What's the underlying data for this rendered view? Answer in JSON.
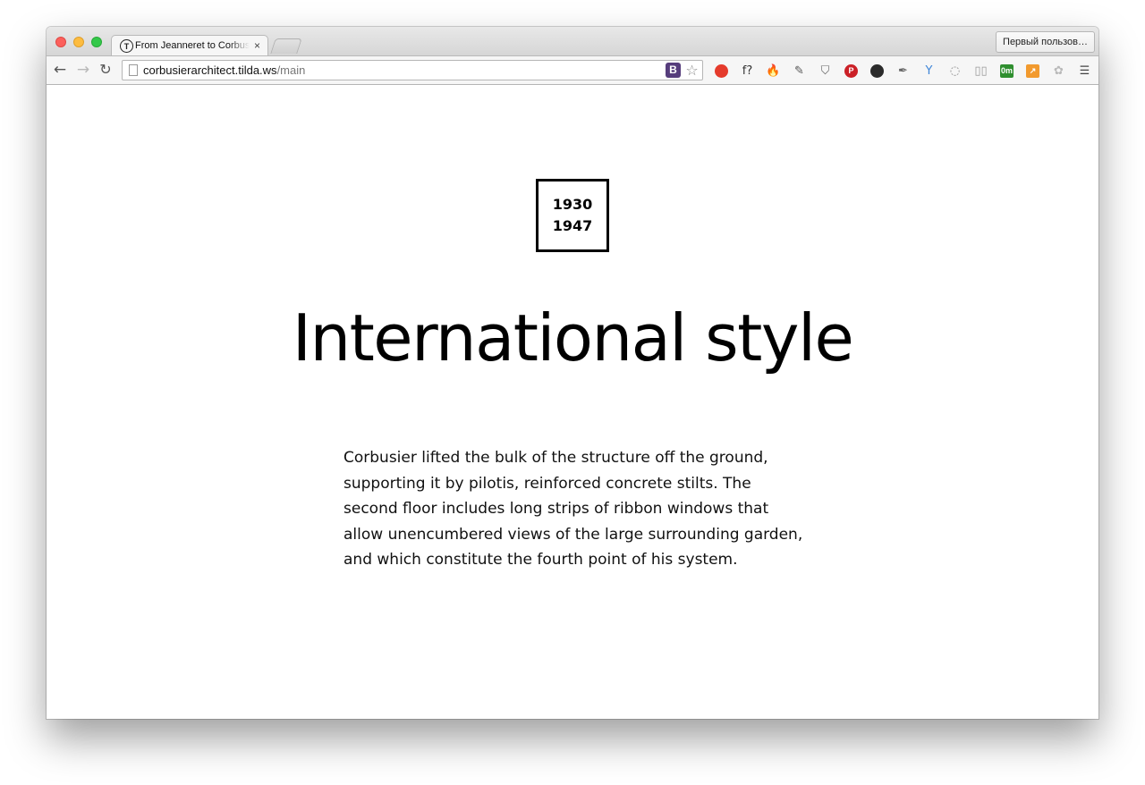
{
  "browser": {
    "tab": {
      "favicon": "T",
      "title": "From Jeanneret to Corbusier",
      "close": "×"
    },
    "profile_button": "Первый пользов…",
    "nav": {
      "back": "←",
      "forward": "→",
      "reload": "↻"
    },
    "address": {
      "host": "corbusierarchitect.tilda.ws",
      "path": "/main"
    },
    "omnibox_icons": {
      "bootstrap": "B",
      "star": "☆"
    },
    "extensions": [
      {
        "name": "adblock-icon",
        "glyph": "",
        "color": "#e53b2c",
        "shape": "dot"
      },
      {
        "name": "font-finder-icon",
        "glyph": "f?",
        "color": "#333333",
        "shape": "text"
      },
      {
        "name": "fire-icon",
        "glyph": "🔥",
        "color": "#f08a24",
        "shape": "text"
      },
      {
        "name": "evernote-icon",
        "glyph": "✎",
        "color": "#555555",
        "shape": "text"
      },
      {
        "name": "pocket-icon",
        "glyph": "⛉",
        "color": "#666666",
        "shape": "text"
      },
      {
        "name": "pinterest-icon",
        "glyph": "P",
        "color": "#cb2027",
        "shape": "dot"
      },
      {
        "name": "lens-icon",
        "glyph": "",
        "color": "#2b2b2b",
        "shape": "dot"
      },
      {
        "name": "eyedropper-icon",
        "glyph": "✒",
        "color": "#666666",
        "shape": "text"
      },
      {
        "name": "yandex-icon",
        "glyph": "Y",
        "color": "#3f86d8",
        "shape": "text"
      },
      {
        "name": "loop-icon",
        "glyph": "◌",
        "color": "#888888",
        "shape": "text"
      },
      {
        "name": "reader-icon",
        "glyph": "▯▯",
        "color": "#999999",
        "shape": "text"
      },
      {
        "name": "timer-icon",
        "glyph": "0m",
        "color": "#2f8f2f",
        "shape": "sq"
      },
      {
        "name": "analytics-icon",
        "glyph": "↗",
        "color": "#f29a2e",
        "shape": "sq"
      },
      {
        "name": "paw-icon",
        "glyph": "✿",
        "color": "#b9b9b9",
        "shape": "text"
      },
      {
        "name": "menu-icon",
        "glyph": "☰",
        "color": "#444444",
        "shape": "text"
      }
    ]
  },
  "page": {
    "years": {
      "start": "1930",
      "end": "1947"
    },
    "heading": "International style",
    "paragraph": "Corbusier lifted the bulk of the structure off the ground, supporting it by pilotis, reinforced concrete stilts. The second floor includes long strips of ribbon windows that allow unencumbered views of the large surrounding garden, and which constitute the fourth point of his system."
  }
}
